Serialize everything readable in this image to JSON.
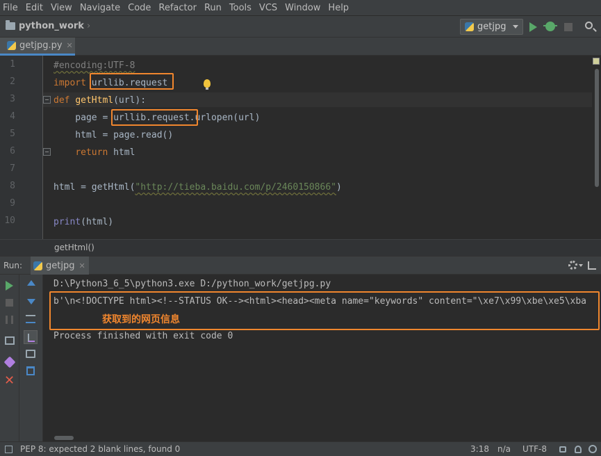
{
  "menu": [
    "File",
    "Edit",
    "View",
    "Navigate",
    "Code",
    "Refactor",
    "Run",
    "Tools",
    "VCS",
    "Window",
    "Help"
  ],
  "nav": {
    "project": "python_work",
    "run_config": "getjpg"
  },
  "editor": {
    "tab_label": "getjpg.py",
    "lines": [
      {
        "num": "1",
        "code": "#encoding:UTF-8"
      },
      {
        "num": "2",
        "code": "import urllib.request"
      },
      {
        "num": "3",
        "code": "def getHtml(url):"
      },
      {
        "num": "4",
        "code": "    page = urllib.request.urlopen(url)"
      },
      {
        "num": "5",
        "code": "    html = page.read()"
      },
      {
        "num": "6",
        "code": "    return html"
      },
      {
        "num": "7",
        "code": ""
      },
      {
        "num": "8",
        "code": "html = getHtml(\"http://tieba.baidu.com/p/2460150866\")"
      },
      {
        "num": "9",
        "code": ""
      },
      {
        "num": "10",
        "code": "print(html)"
      }
    ],
    "breadcrumb": "getHtml()"
  },
  "run": {
    "label": "Run:",
    "tab_label": "getjpg",
    "output": [
      "D:\\Python3_6_5\\python3.exe D:/python_work/getjpg.py",
      "b'\\n<!DOCTYPE html><!--STATUS OK--><html><head><meta name=\"keywords\" content=\"\\xe7\\x99\\xbe\\xe5\\xba",
      "Process finished with exit code 0"
    ],
    "annotation": "获取到的网页信息"
  },
  "status": {
    "message": "PEP 8: expected 2 blank lines, found 0",
    "position": "3:18",
    "separator": "n/a",
    "encoding": "UTF-8"
  },
  "colors": {
    "highlight": "#f0862e",
    "keyword": "#cc7832",
    "function": "#ffc66d",
    "string": "#6a8759"
  }
}
